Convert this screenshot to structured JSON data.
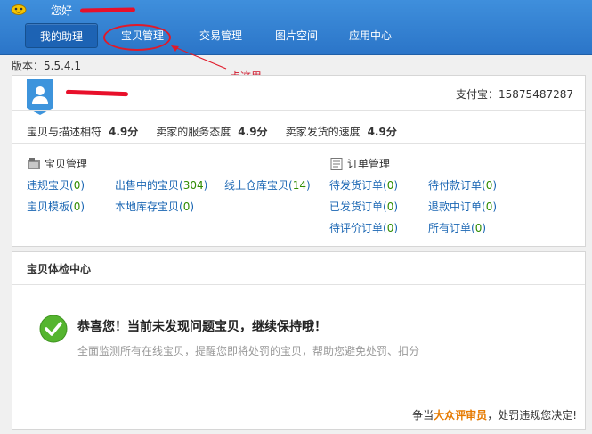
{
  "header": {
    "greeting": "您好",
    "nav": [
      {
        "label": "我的助理"
      },
      {
        "label": "宝贝管理"
      },
      {
        "label": "交易管理"
      },
      {
        "label": "图片空间"
      },
      {
        "label": "应用中心"
      }
    ]
  },
  "annotation": {
    "text": "点这里",
    "color": "#e01a2a"
  },
  "version": "版本：5.5.4.1",
  "profile": {
    "alipay": "支付宝：15875487287",
    "ratings": [
      {
        "label": "宝贝与描述相符",
        "value": "4.9分"
      },
      {
        "label": "卖家的服务态度",
        "value": "4.9分"
      },
      {
        "label": "卖家发货的速度",
        "value": "4.9分"
      }
    ]
  },
  "item_mgmt": {
    "title": "宝贝管理",
    "links": [
      {
        "label": "违规宝贝",
        "count": "0"
      },
      {
        "label": "出售中的宝贝",
        "count": "304"
      },
      {
        "label": "线上仓库宝贝",
        "count": "14"
      },
      {
        "label": "宝贝模板",
        "count": "0"
      },
      {
        "label": "本地库存宝贝",
        "count": "0"
      }
    ]
  },
  "order_mgmt": {
    "title": "订单管理",
    "links": [
      {
        "label": "待发货订单",
        "count": "0"
      },
      {
        "label": "待付款订单",
        "count": "0"
      },
      {
        "label": "已发货订单",
        "count": "0"
      },
      {
        "label": "退款中订单",
        "count": "0"
      },
      {
        "label": "待评价订单",
        "count": "0"
      },
      {
        "label": "所有订单",
        "count": "0"
      }
    ]
  },
  "health": {
    "title": "宝贝体检中心",
    "congrats": "恭喜您！当前未发现问题宝贝，继续保持哦！",
    "sub": "全面监测所有在线宝贝，提醒您即将处罚的宝贝，帮助您避免处罚、扣分",
    "footer_pre": "争当",
    "footer_link": "大众评审员",
    "footer_post": "，处罚违规您决定!"
  },
  "colors": {
    "topbar": "#2b75c8",
    "nav_active": "#1d63b4",
    "link": "#1a66b3",
    "count": "#2e8b00",
    "highlight": "#e67a00",
    "check": "#55b52f"
  }
}
